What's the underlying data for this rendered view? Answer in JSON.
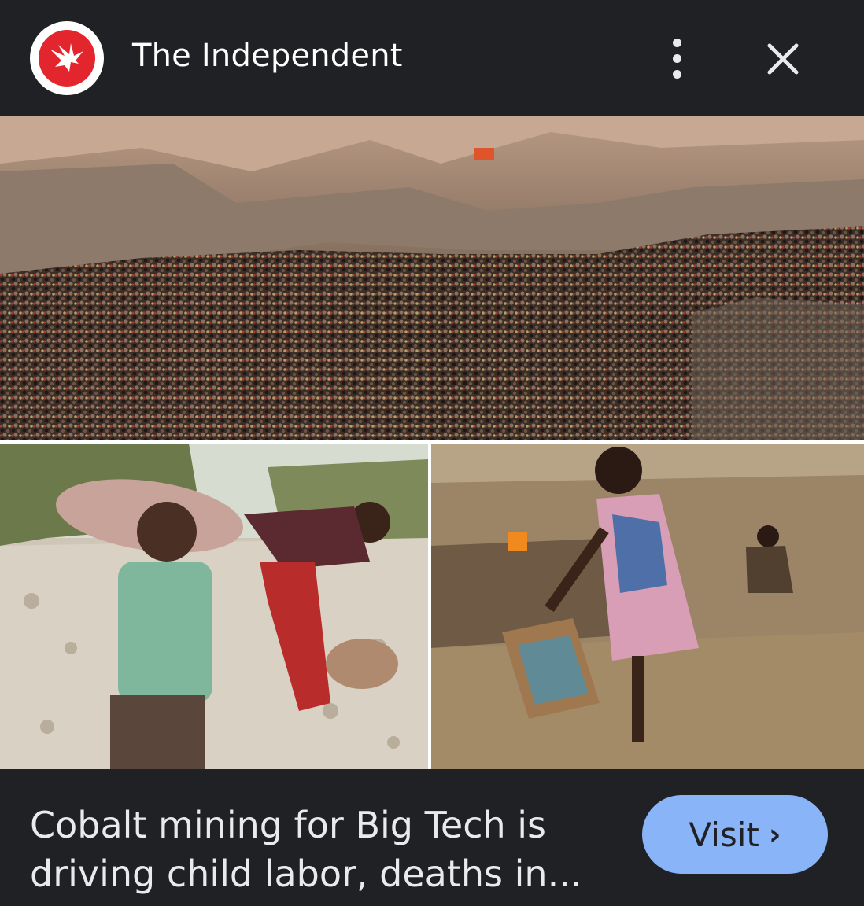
{
  "header": {
    "source_name": "The Independent",
    "logo_icon": "eagle-icon",
    "more_icon": "more-vert-icon",
    "close_icon": "close-icon"
  },
  "images": [
    {
      "description_icon": "photo-crowded-mine"
    },
    {
      "description_icon": "photo-boys-carrying-sacks"
    },
    {
      "description_icon": "photo-woman-with-baby"
    }
  ],
  "lens": {
    "icon": "google-lens-icon"
  },
  "footer": {
    "headline": "Cobalt mining for Big Tech is driving child labor, deaths in...",
    "visit_label": "Visit",
    "visit_icon": "chevron-right-icon"
  },
  "colors": {
    "background": "#202124",
    "logo_red": "#e3262d",
    "visit_button": "#8ab4f8"
  }
}
